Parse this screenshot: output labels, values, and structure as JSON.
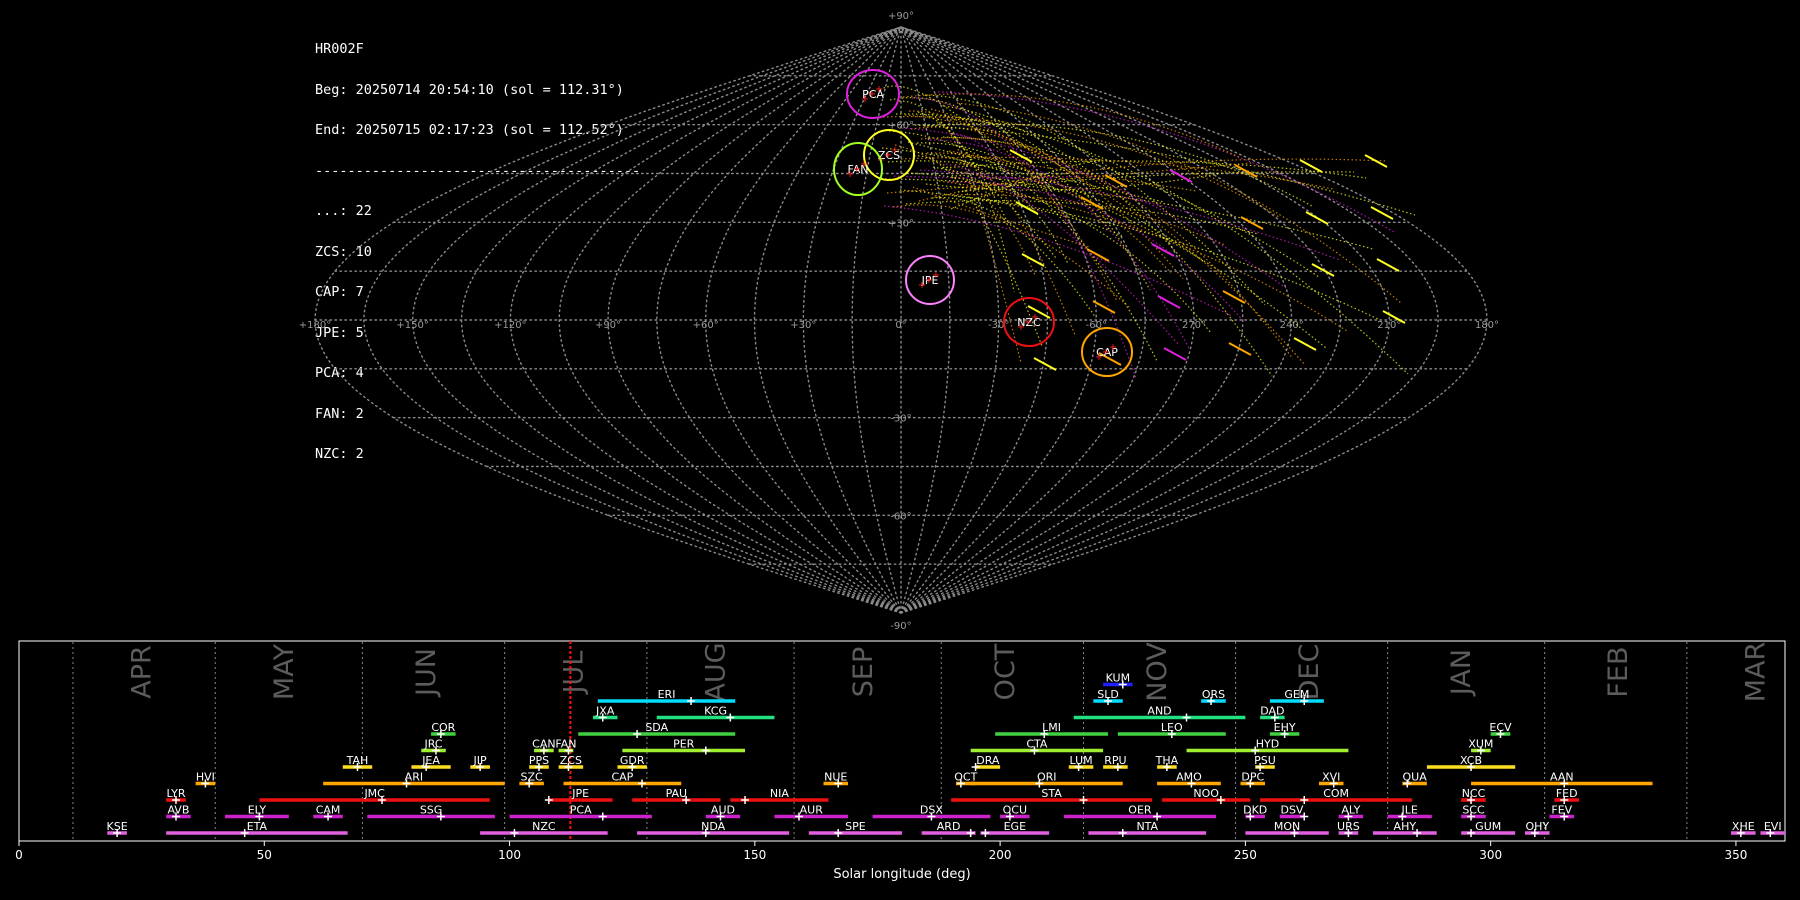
{
  "info": {
    "lines": [
      "HR002F",
      "Beg: 20250714 20:54:10 (sol = 112.31°)",
      "End: 20250715 02:17:23 (sol = 112.52°)",
      "----------------------------------------",
      "...: 22",
      "ZCS: 10",
      "CAP: 7",
      "JPE: 5",
      "PCA: 4",
      "FAN: 2",
      "NZC: 2"
    ]
  },
  "sky_map": {
    "projection": "sinusoidal",
    "lat_labels": [
      "+90°",
      "+60°",
      "+30°",
      "0°",
      "-30°",
      "-60°",
      "-90°"
    ],
    "lon_labels": [
      "+180°",
      "+150°",
      "+120°",
      "+90°",
      "+60°",
      "+30°",
      "0°",
      "-30°",
      "-60°",
      "270°",
      "240°",
      "210°",
      "180°"
    ],
    "showers": [
      {
        "code": "PCA",
        "color": "#e020e0"
      },
      {
        "code": "ZCS",
        "color": "#ffff20"
      },
      {
        "code": "FAN",
        "color": "#a0ff20"
      },
      {
        "code": "JPE",
        "color": "#ff80ff"
      },
      {
        "code": "NZC",
        "color": "#ee1010"
      },
      {
        "code": "CAP",
        "color": "#ffa500"
      }
    ]
  },
  "chart_data": {
    "type": "timeline",
    "xlabel": "Solar longitude (deg)",
    "xlim": [
      0,
      360
    ],
    "xticks": [
      0,
      50,
      100,
      150,
      200,
      250,
      300,
      350
    ],
    "current_sol": 112.4,
    "months": [
      {
        "label": "APR",
        "at": 25
      },
      {
        "label": "MAY",
        "at": 54
      },
      {
        "label": "JUN",
        "at": 83
      },
      {
        "label": "JUL",
        "at": 113
      },
      {
        "label": "AUG",
        "at": 142
      },
      {
        "label": "SEP",
        "at": 172
      },
      {
        "label": "OCT",
        "at": 201
      },
      {
        "label": "NOV",
        "at": 232
      },
      {
        "label": "DEC",
        "at": 263
      },
      {
        "label": "JAN",
        "at": 294
      },
      {
        "label": "FEB",
        "at": 326
      },
      {
        "label": "MAR",
        "at": 354
      }
    ],
    "month_boundaries": [
      11,
      40,
      70,
      99,
      128,
      158,
      188,
      217,
      248,
      279,
      311,
      340
    ],
    "showers": [
      {
        "code": "KUM",
        "start": 221,
        "peak": 225,
        "end": 227,
        "row": 9,
        "color": "#2020ff"
      },
      {
        "code": "ERI",
        "start": 118,
        "peak": 137,
        "end": 146,
        "row": 8,
        "color": "#00ddff"
      },
      {
        "code": "SLD",
        "start": 219,
        "peak": 222,
        "end": 225,
        "row": 8,
        "color": "#00ddff"
      },
      {
        "code": "ORS",
        "start": 241,
        "peak": 243,
        "end": 246,
        "row": 8,
        "color": "#00ddff"
      },
      {
        "code": "GEM",
        "start": 255,
        "peak": 262,
        "end": 266,
        "row": 8,
        "color": "#00ddff"
      },
      {
        "code": "JXA",
        "start": 117,
        "peak": 119,
        "end": 122,
        "row": 7,
        "color": "#20e080"
      },
      {
        "code": "KCG",
        "start": 130,
        "peak": 145,
        "end": 154,
        "row": 7,
        "color": "#20e080"
      },
      {
        "code": "AND",
        "start": 215,
        "peak": 238,
        "end": 250,
        "row": 7,
        "color": "#20e080"
      },
      {
        "code": "DAD",
        "start": 253,
        "peak": 256,
        "end": 258,
        "row": 7,
        "color": "#20e080"
      },
      {
        "code": "COR",
        "start": 84,
        "peak": 86,
        "end": 89,
        "row": 6,
        "color": "#40d040"
      },
      {
        "code": "SDA",
        "start": 114,
        "peak": 126,
        "end": 146,
        "row": 6,
        "color": "#40d040"
      },
      {
        "code": "LMI",
        "start": 199,
        "peak": 209,
        "end": 222,
        "row": 6,
        "color": "#40d040"
      },
      {
        "code": "LEO",
        "start": 224,
        "peak": 235,
        "end": 246,
        "row": 6,
        "color": "#40d040"
      },
      {
        "code": "EHY",
        "start": 255,
        "peak": 258,
        "end": 261,
        "row": 6,
        "color": "#40d040"
      },
      {
        "code": "ECV",
        "start": 300,
        "peak": 302,
        "end": 304,
        "row": 6,
        "color": "#40d040"
      },
      {
        "code": "JRC",
        "start": 82,
        "peak": 85,
        "end": 87,
        "row": 5,
        "color": "#a0ee30"
      },
      {
        "code": "CAN",
        "start": 105,
        "peak": 107,
        "end": 109,
        "row": 5,
        "color": "#a0ee30"
      },
      {
        "code": "FAN",
        "start": 110,
        "peak": 112,
        "end": 113,
        "row": 5,
        "color": "#a0ee30"
      },
      {
        "code": "PER",
        "start": 123,
        "peak": 140,
        "end": 148,
        "row": 5,
        "color": "#a0ee30"
      },
      {
        "code": "CTA",
        "start": 194,
        "peak": 207,
        "end": 221,
        "row": 5,
        "color": "#a0ee30"
      },
      {
        "code": "HYD",
        "start": 238,
        "peak": 252,
        "end": 271,
        "row": 5,
        "color": "#a0ee30"
      },
      {
        "code": "XUM",
        "start": 296,
        "peak": 298,
        "end": 300,
        "row": 5,
        "color": "#a0ee30"
      },
      {
        "code": "TAH",
        "start": 66,
        "peak": 69,
        "end": 72,
        "row": 4,
        "color": "#ffdd20"
      },
      {
        "code": "JEA",
        "start": 80,
        "peak": 83,
        "end": 88,
        "row": 4,
        "color": "#ffdd20"
      },
      {
        "code": "JIP",
        "start": 92,
        "peak": 94,
        "end": 96,
        "row": 4,
        "color": "#ffdd20"
      },
      {
        "code": "PPS",
        "start": 104,
        "peak": 106,
        "end": 108,
        "row": 4,
        "color": "#ffdd20"
      },
      {
        "code": "ZCS",
        "start": 110,
        "peak": 112,
        "end": 115,
        "row": 4,
        "color": "#ffdd20"
      },
      {
        "code": "GDR",
        "start": 122,
        "peak": 125,
        "end": 128,
        "row": 4,
        "color": "#ffdd20"
      },
      {
        "code": "DRA",
        "start": 195,
        "peak": 195,
        "end": 200,
        "row": 4,
        "color": "#ffdd20"
      },
      {
        "code": "LUM",
        "start": 214,
        "peak": 216,
        "end": 219,
        "row": 4,
        "color": "#ffdd20"
      },
      {
        "code": "RPU",
        "start": 221,
        "peak": 224,
        "end": 226,
        "row": 4,
        "color": "#ffdd20"
      },
      {
        "code": "THA",
        "start": 232,
        "peak": 234,
        "end": 236,
        "row": 4,
        "color": "#ffdd20"
      },
      {
        "code": "PSU",
        "start": 252,
        "peak": 253,
        "end": 256,
        "row": 4,
        "color": "#ffdd20"
      },
      {
        "code": "XCB",
        "start": 287,
        "peak": 296,
        "end": 305,
        "row": 4,
        "color": "#ffdd20"
      },
      {
        "code": "HVI",
        "start": 36,
        "peak": 38,
        "end": 40,
        "row": 3,
        "color": "#ffa500"
      },
      {
        "code": "ARI",
        "start": 62,
        "peak": 79,
        "end": 99,
        "row": 3,
        "color": "#ffa500"
      },
      {
        "code": "SZC",
        "start": 102,
        "peak": 104,
        "end": 107,
        "row": 3,
        "color": "#ffa500"
      },
      {
        "code": "CAP",
        "start": 111,
        "peak": 127,
        "end": 135,
        "row": 3,
        "color": "#ffa500"
      },
      {
        "code": "NUE",
        "start": 164,
        "peak": 167,
        "end": 169,
        "row": 3,
        "color": "#ffa500"
      },
      {
        "code": "OCT",
        "start": 191,
        "peak": 192,
        "end": 195,
        "row": 3,
        "color": "#ffa500"
      },
      {
        "code": "ORI",
        "start": 194,
        "peak": 208,
        "end": 225,
        "row": 3,
        "color": "#ffa500"
      },
      {
        "code": "AMO",
        "start": 232,
        "peak": 239,
        "end": 245,
        "row": 3,
        "color": "#ffa500"
      },
      {
        "code": "DPC",
        "start": 249,
        "peak": 251,
        "end": 254,
        "row": 3,
        "color": "#ffa500"
      },
      {
        "code": "XVI",
        "start": 265,
        "peak": 268,
        "end": 270,
        "row": 3,
        "color": "#ffa500"
      },
      {
        "code": "QUA",
        "start": 282,
        "peak": 283,
        "end": 287,
        "row": 3,
        "color": "#ffa500"
      },
      {
        "code": "AAN",
        "start": 296,
        "peak": 315,
        "end": 333,
        "row": 3,
        "color": "#ffa500"
      },
      {
        "code": "LYR",
        "start": 30,
        "peak": 32,
        "end": 34,
        "row": 2,
        "color": "#ee1010"
      },
      {
        "code": "JMC",
        "start": 49,
        "peak": 74,
        "end": 96,
        "row": 2,
        "color": "#ee1010"
      },
      {
        "code": "JPE",
        "start": 108,
        "peak": 108,
        "end": 121,
        "row": 2,
        "color": "#ee1010"
      },
      {
        "code": "PAU",
        "start": 125,
        "peak": 136,
        "end": 143,
        "row": 2,
        "color": "#ee1010"
      },
      {
        "code": "NIA",
        "start": 145,
        "peak": 148,
        "end": 165,
        "row": 2,
        "color": "#ee1010"
      },
      {
        "code": "STA",
        "start": 190,
        "peak": 217,
        "end": 231,
        "row": 2,
        "color": "#ee1010"
      },
      {
        "code": "NOO",
        "start": 233,
        "peak": 245,
        "end": 251,
        "row": 2,
        "color": "#ee1010"
      },
      {
        "code": "COM",
        "start": 253,
        "peak": 262,
        "end": 284,
        "row": 2,
        "color": "#ee1010"
      },
      {
        "code": "NCC",
        "start": 294,
        "peak": 296,
        "end": 299,
        "row": 2,
        "color": "#ee1010"
      },
      {
        "code": "FED",
        "start": 313,
        "peak": 315,
        "end": 318,
        "row": 2,
        "color": "#ee1010"
      },
      {
        "code": "AVB",
        "start": 30,
        "peak": 32,
        "end": 35,
        "row": 1,
        "color": "#cc22cc"
      },
      {
        "code": "ELY",
        "start": 42,
        "peak": 49,
        "end": 55,
        "row": 1,
        "color": "#cc22cc"
      },
      {
        "code": "CAM",
        "start": 60,
        "peak": 63,
        "end": 66,
        "row": 1,
        "color": "#cc22cc"
      },
      {
        "code": "SSG",
        "start": 71,
        "peak": 86,
        "end": 97,
        "row": 1,
        "color": "#cc22cc"
      },
      {
        "code": "PCA",
        "start": 100,
        "peak": 119,
        "end": 129,
        "row": 1,
        "color": "#cc22cc"
      },
      {
        "code": "AUD",
        "start": 140,
        "peak": 143,
        "end": 147,
        "row": 1,
        "color": "#cc22cc"
      },
      {
        "code": "AUR",
        "start": 154,
        "peak": 159,
        "end": 169,
        "row": 1,
        "color": "#cc22cc"
      },
      {
        "code": "DSX",
        "start": 174,
        "peak": 186,
        "end": 198,
        "row": 1,
        "color": "#cc22cc"
      },
      {
        "code": "OCU",
        "start": 200,
        "peak": 202,
        "end": 206,
        "row": 1,
        "color": "#cc22cc"
      },
      {
        "code": "OER",
        "start": 213,
        "peak": 232,
        "end": 244,
        "row": 1,
        "color": "#cc22cc"
      },
      {
        "code": "DKD",
        "start": 250,
        "peak": 251,
        "end": 254,
        "row": 1,
        "color": "#cc22cc"
      },
      {
        "code": "DSV",
        "start": 257,
        "peak": 262,
        "end": 262,
        "row": 1,
        "color": "#cc22cc"
      },
      {
        "code": "ALY",
        "start": 269,
        "peak": 271,
        "end": 274,
        "row": 1,
        "color": "#cc22cc"
      },
      {
        "code": "JLE",
        "start": 279,
        "peak": 282,
        "end": 288,
        "row": 1,
        "color": "#cc22cc"
      },
      {
        "code": "SCC",
        "start": 294,
        "peak": 296,
        "end": 299,
        "row": 1,
        "color": "#cc22cc"
      },
      {
        "code": "FEV",
        "start": 312,
        "peak": 315,
        "end": 317,
        "row": 1,
        "color": "#cc22cc"
      },
      {
        "code": "KSE",
        "start": 18,
        "peak": 20,
        "end": 22,
        "row": 0,
        "color": "#e060e0"
      },
      {
        "code": "ETA",
        "start": 30,
        "peak": 46,
        "end": 67,
        "row": 0,
        "color": "#e060e0"
      },
      {
        "code": "NZC",
        "start": 94,
        "peak": 101,
        "end": 120,
        "row": 0,
        "color": "#e060e0"
      },
      {
        "code": "NDA",
        "start": 126,
        "peak": 140,
        "end": 157,
        "row": 0,
        "color": "#e060e0"
      },
      {
        "code": "SPE",
        "start": 161,
        "peak": 167,
        "end": 180,
        "row": 0,
        "color": "#e060e0"
      },
      {
        "code": "ARD",
        "start": 184,
        "peak": 194,
        "end": 195,
        "row": 0,
        "color": "#e060e0"
      },
      {
        "code": "EGE",
        "start": 196,
        "peak": 197,
        "end": 210,
        "row": 0,
        "color": "#e060e0"
      },
      {
        "code": "NTA",
        "start": 218,
        "peak": 225,
        "end": 242,
        "row": 0,
        "color": "#e060e0"
      },
      {
        "code": "MON",
        "start": 250,
        "peak": 260,
        "end": 267,
        "row": 0,
        "color": "#e060e0"
      },
      {
        "code": "URS",
        "start": 269,
        "peak": 271,
        "end": 273,
        "row": 0,
        "color": "#e060e0"
      },
      {
        "code": "AHY",
        "start": 276,
        "peak": 285,
        "end": 289,
        "row": 0,
        "color": "#e060e0"
      },
      {
        "code": "GUM",
        "start": 294,
        "peak": 296,
        "end": 305,
        "row": 0,
        "color": "#e060e0"
      },
      {
        "code": "OHY",
        "start": 307,
        "peak": 309,
        "end": 312,
        "row": 0,
        "color": "#e060e0"
      },
      {
        "code": "XHE",
        "start": 349,
        "peak": 351,
        "end": 354,
        "row": 0,
        "color": "#e060e0"
      },
      {
        "code": "EVI",
        "start": 355,
        "peak": 357,
        "end": 360,
        "row": 0,
        "color": "#e060e0"
      }
    ]
  }
}
